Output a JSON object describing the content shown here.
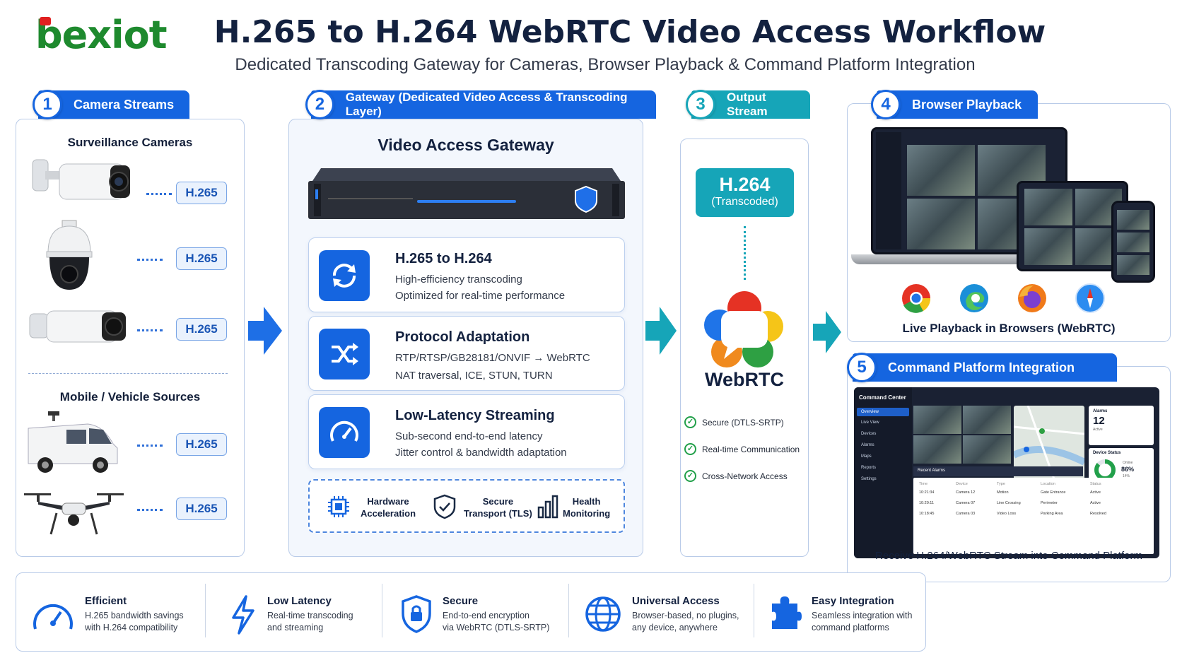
{
  "logo": {
    "text": "bexiot"
  },
  "header": {
    "title": "H.265 to H.264 WebRTC Video Access Workflow",
    "subtitle": "Dedicated Transcoding Gateway for Cameras, Browser Playback & Command Platform Integration"
  },
  "steps": [
    {
      "num": "1",
      "label": "Camera Streams"
    },
    {
      "num": "2",
      "label": "Gateway (Dedicated Video Access & Transcoding Layer)"
    },
    {
      "num": "3",
      "label": "Output Stream"
    },
    {
      "num": "4",
      "label": "Browser Playback"
    },
    {
      "num": "5",
      "label": "Command Platform Integration"
    }
  ],
  "cameras": {
    "surveillance_heading": "Surveillance Cameras",
    "mobile_heading": "Mobile / Vehicle Sources",
    "codec": "H.265"
  },
  "gateway": {
    "heading": "Video Access Gateway",
    "features": [
      {
        "icon": "refresh-icon",
        "title": "H.265 to H.264",
        "line1": "High-efficiency transcoding",
        "line2": "Optimized for real-time performance"
      },
      {
        "icon": "shuffle-icon",
        "title": "Protocol Adaptation",
        "line1": "RTP/RTSP/GB28181/ONVIF → WebRTC",
        "line2": "NAT traversal, ICE, STUN, TURN"
      },
      {
        "icon": "speedometer-icon",
        "title": "Low-Latency Streaming",
        "line1": "Sub-second end-to-end latency",
        "line2": "Jitter control & bandwidth adaptation"
      }
    ],
    "capabilities": [
      {
        "icon": "chip-icon",
        "line1": "Hardware",
        "line2": "Acceleration"
      },
      {
        "icon": "shield-check-icon",
        "line1": "Secure",
        "line2": "Transport (TLS)"
      },
      {
        "icon": "bar-chart-icon",
        "line1": "Health",
        "line2": "Monitoring"
      }
    ]
  },
  "output": {
    "codec": "H.264",
    "codec_note": "(Transcoded)",
    "protocol": "WebRTC",
    "checks": [
      "Secure (DTLS-SRTP)",
      "Real-time Communication",
      "Cross-Network Access"
    ]
  },
  "browser": {
    "caption": "Live Playback in Browsers (WebRTC)",
    "browsers": [
      "chrome-icon",
      "edge-icon",
      "firefox-icon",
      "safari-icon"
    ]
  },
  "command": {
    "caption": "Receive H.264/WebRTC Stream into Command Platform",
    "app_title": "Command Center",
    "nav": [
      "Overview",
      "Live View",
      "Devices",
      "Alarms",
      "Maps",
      "Reports",
      "Settings"
    ],
    "alarms_label": "Alarms",
    "alarms_value": "12",
    "alarms_sub": "Active",
    "device_status_label": "Device Status",
    "online_label": "Online",
    "online_value": "86%",
    "offline_value": "14%",
    "online_fraction": 0.86,
    "recent_alarms_label": "Recent Alarms",
    "table_headers": [
      "Time",
      "Device",
      "Type",
      "Location",
      "Status"
    ],
    "table_rows": [
      [
        "10:21:34",
        "Camera 12",
        "Motion",
        "Gate Entrance",
        "Active"
      ],
      [
        "10:20:11",
        "Camera 07",
        "Line Crossing",
        "Perimeter",
        "Active"
      ],
      [
        "10:18:45",
        "Camera 03",
        "Video Loss",
        "Parking Area",
        "Resolved"
      ]
    ]
  },
  "benefits": [
    {
      "icon": "gauge-icon",
      "title": "Efficient",
      "line1": "H.265 bandwidth savings",
      "line2": "with H.264 compatibility"
    },
    {
      "icon": "lightning-icon",
      "title": "Low Latency",
      "line1": "Real-time transcoding",
      "line2": "and streaming"
    },
    {
      "icon": "lock-shield-icon",
      "title": "Secure",
      "line1": "End-to-end encryption",
      "line2": "via WebRTC (DTLS-SRTP)"
    },
    {
      "icon": "globe-icon",
      "title": "Universal Access",
      "line1": "Browser-based, no plugins,",
      "line2": "any device, anywhere"
    },
    {
      "icon": "puzzle-icon",
      "title": "Easy Integration",
      "line1": "Seamless integration with",
      "line2": "command platforms"
    }
  ],
  "colors": {
    "primary": "#1565e0",
    "teal": "#16a5b8",
    "logo_green": "#1e8a2e",
    "logo_red": "#e02020",
    "check_green": "#22a04a"
  }
}
